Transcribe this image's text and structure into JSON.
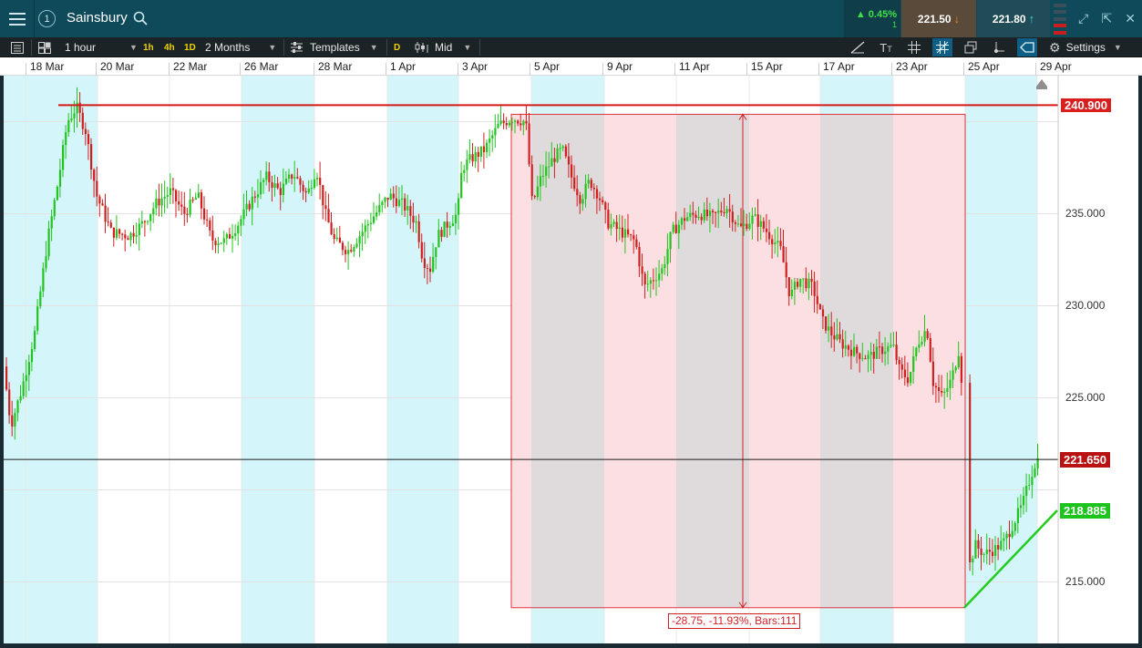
{
  "titlebar": {
    "instrument": "Sainsbury",
    "window_number": "1",
    "change_pct": "▲ 0.45%",
    "change_sub": "1",
    "sell_price": "221.50",
    "buy_price": "221.80"
  },
  "toolbar": {
    "interval": "1 hour",
    "quick_intervals": [
      "1h",
      "4h",
      "1D"
    ],
    "range": "2 Months",
    "templates_label": "Templates",
    "price_type_badge": "D",
    "price_type": "Mid",
    "settings_label": "Settings"
  },
  "date_axis": [
    "18 Mar",
    "20 Mar",
    "22 Mar",
    "26 Mar",
    "28 Mar",
    "1 Apr",
    "3 Apr",
    "5 Apr",
    "9 Apr",
    "11 Apr",
    "15 Apr",
    "17 Apr",
    "23 Apr",
    "25 Apr",
    "29 Apr"
  ],
  "price_axis": [
    "235.000",
    "230.000",
    "225.000",
    "215.000"
  ],
  "price_tags": {
    "resistance": "240.900",
    "current": "221.650",
    "trendline": "218.885"
  },
  "measure_label": "-28.75, -11.93%, Bars:111",
  "colors": {
    "up": "#22c41e",
    "down": "#d11f1f",
    "band": "#d4f6fa",
    "measure_fill": "#fbdfe2",
    "measure_gray": "#d9dbdc",
    "current_tag": "#b81212",
    "trend_tag": "#1ec41e"
  },
  "chart_data": {
    "type": "candlestick",
    "instrument": "Sainsbury",
    "interval": "1 hour",
    "y_range": [
      212.5,
      247.5
    ],
    "x_labels": [
      "18 Mar",
      "20 Mar",
      "22 Mar",
      "26 Mar",
      "28 Mar",
      "1 Apr",
      "3 Apr",
      "5 Apr",
      "9 Apr",
      "11 Apr",
      "15 Apr",
      "17 Apr",
      "23 Apr",
      "25 Apr",
      "29 Apr"
    ],
    "y_ticks": [
      215,
      225,
      230,
      235
    ],
    "price_path": [
      [
        0,
        227.5
      ],
      [
        10,
        223.5
      ],
      [
        22,
        225.5
      ],
      [
        36,
        228.5
      ],
      [
        50,
        233.5
      ],
      [
        62,
        236.8
      ],
      [
        72,
        240.0
      ],
      [
        82,
        240.8
      ],
      [
        92,
        239.5
      ],
      [
        104,
        236.0
      ],
      [
        120,
        234.0
      ],
      [
        140,
        233.8
      ],
      [
        155,
        234.5
      ],
      [
        170,
        235.6
      ],
      [
        185,
        236.2
      ],
      [
        200,
        235.0
      ],
      [
        215,
        236.0
      ],
      [
        230,
        233.6
      ],
      [
        245,
        233.5
      ],
      [
        260,
        234.5
      ],
      [
        275,
        235.8
      ],
      [
        290,
        237.0
      ],
      [
        305,
        236.2
      ],
      [
        320,
        237.2
      ],
      [
        335,
        236.0
      ],
      [
        345,
        237.5
      ],
      [
        355,
        235.0
      ],
      [
        365,
        233.5
      ],
      [
        380,
        233.0
      ],
      [
        395,
        234.0
      ],
      [
        410,
        235.0
      ],
      [
        425,
        236.0
      ],
      [
        440,
        235.5
      ],
      [
        455,
        234.5
      ],
      [
        462,
        232.5
      ],
      [
        470,
        232.0
      ],
      [
        478,
        233.8
      ],
      [
        490,
        234.5
      ],
      [
        500,
        235.0
      ],
      [
        505,
        237.5
      ],
      [
        515,
        238.0
      ],
      [
        530,
        238.5
      ],
      [
        545,
        239.8
      ],
      [
        560,
        240.2
      ],
      [
        575,
        240.0
      ],
      [
        582,
        235.5
      ],
      [
        592,
        237.0
      ],
      [
        605,
        238.0
      ],
      [
        615,
        238.5
      ],
      [
        625,
        237.0
      ],
      [
        635,
        235.8
      ],
      [
        645,
        236.8
      ],
      [
        655,
        236.0
      ],
      [
        665,
        234.5
      ],
      [
        680,
        234.0
      ],
      [
        695,
        233.5
      ],
      [
        705,
        231.0
      ],
      [
        715,
        231.5
      ],
      [
        725,
        232.0
      ],
      [
        735,
        234.0
      ],
      [
        750,
        234.8
      ],
      [
        765,
        235.0
      ],
      [
        780,
        234.8
      ],
      [
        795,
        235.4
      ],
      [
        810,
        234.2
      ],
      [
        825,
        234.8
      ],
      [
        840,
        234.0
      ],
      [
        855,
        233.0
      ],
      [
        865,
        230.5
      ],
      [
        875,
        231.5
      ],
      [
        890,
        231.0
      ],
      [
        900,
        229.2
      ],
      [
        910,
        228.5
      ],
      [
        920,
        228.0
      ],
      [
        935,
        227.5
      ],
      [
        950,
        227.2
      ],
      [
        965,
        227.6
      ],
      [
        978,
        227.8
      ],
      [
        985,
        226.5
      ],
      [
        995,
        226.0
      ],
      [
        1005,
        228.0
      ],
      [
        1015,
        228.8
      ],
      [
        1022,
        225.8
      ],
      [
        1032,
        225.0
      ],
      [
        1042,
        226.0
      ],
      [
        1052,
        228.0
      ],
      [
        1058,
        215.2
      ],
      [
        1068,
        217.0
      ],
      [
        1078,
        216.5
      ],
      [
        1090,
        216.8
      ],
      [
        1100,
        217.2
      ],
      [
        1110,
        218.2
      ],
      [
        1120,
        219.2
      ],
      [
        1128,
        220.6
      ],
      [
        1135,
        221.65
      ]
    ],
    "resistance_level": 240.9,
    "current_price": 221.65,
    "trendline": {
      "from": [
        1058,
        213.6
      ],
      "to": [
        1160,
        218.885
      ],
      "value": 218.885
    },
    "measurement": {
      "change": -28.75,
      "change_pct": -11.93,
      "bars": 111,
      "from_price": 240.4,
      "to_price": 213.6
    }
  }
}
